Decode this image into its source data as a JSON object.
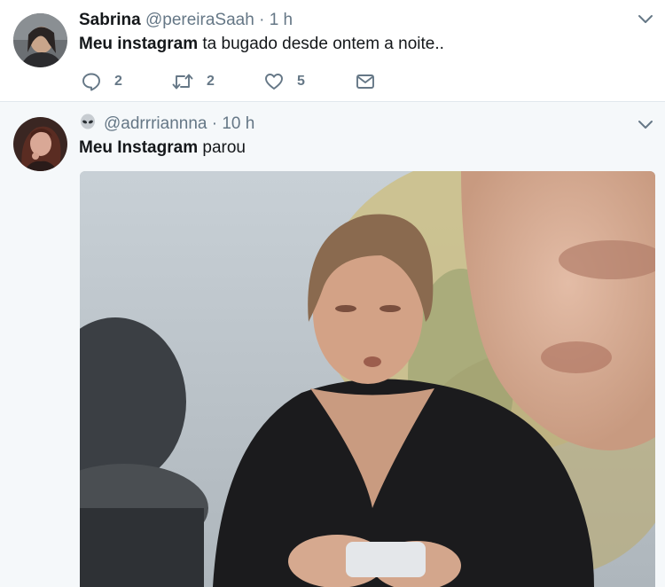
{
  "tweets": [
    {
      "name": "Sabrina",
      "handle": "@pereiraSaah",
      "separator": "·",
      "time": "1 h",
      "text_bold": "Meu instagram",
      "text_rest": " ta bugado desde ontem a noite..",
      "actions": {
        "reply_count": "2",
        "retweet_count": "2",
        "like_count": "5"
      }
    },
    {
      "name_emoji": "alien-icon",
      "handle": "@adrrriannna",
      "separator": "·",
      "time": "10 h",
      "text_bold": "Meu Instagram",
      "text_rest": " parou",
      "media": {
        "type": "photo"
      }
    }
  ],
  "colors": {
    "background": "#f5f8fa",
    "card": "#ffffff",
    "text": "#14171a",
    "muted": "#657786",
    "divider": "#e1e8ed"
  },
  "icons": [
    "reply-icon",
    "retweet-icon",
    "like-icon",
    "direct-message-icon",
    "chevron-down-icon"
  ]
}
